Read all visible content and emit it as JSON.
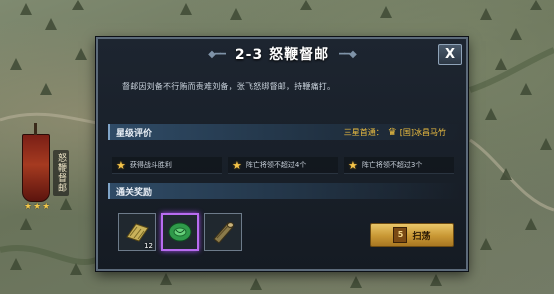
{
  "dialog": {
    "title": "2-3 怒鞭督邮",
    "close_label": "X",
    "description": "督邮因刘备不行贿而责难刘备，张飞怒绑督邮，持鞭痛打。"
  },
  "star_rating": {
    "header": "星级评价",
    "first_pass_label": "三星首通：",
    "first_pass_player": "[国]冰昌马竹",
    "conditions": [
      "获得战斗胜利",
      "阵亡将领不超过4个",
      "阵亡将领不超过3个"
    ]
  },
  "rewards": {
    "header": "通关奖励",
    "items": [
      {
        "icon": "scroll-fan-icon",
        "count": "12"
      },
      {
        "icon": "jade-disc-icon",
        "count": ""
      },
      {
        "icon": "wood-log-icon",
        "count": ""
      }
    ]
  },
  "sweep": {
    "count": "5",
    "label": "扫荡"
  },
  "map": {
    "banner_label": "怒鞭督邮",
    "banner_stars": "★★★"
  },
  "colors": {
    "accent_gold": "#f0c040",
    "dialog_bg": "#1d2530",
    "selected_border": "#b86cf0"
  }
}
